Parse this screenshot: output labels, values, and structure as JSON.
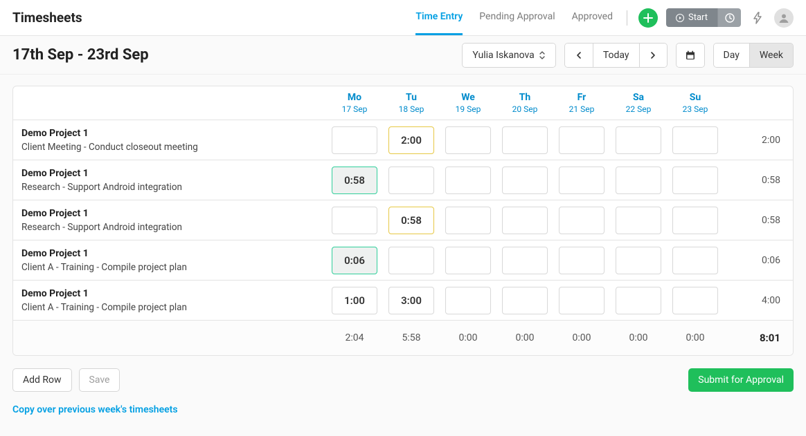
{
  "header": {
    "title": "Timesheets",
    "tabs": [
      "Time Entry",
      "Pending Approval",
      "Approved"
    ],
    "active_tab": 0,
    "start_label": "Start"
  },
  "subbar": {
    "date_range": "17th Sep - 23rd Sep",
    "user": "Yulia Iskanova",
    "today_label": "Today",
    "view": {
      "day": "Day",
      "week": "Week",
      "active": "week"
    }
  },
  "days": [
    {
      "short": "Mo",
      "date": "17 Sep"
    },
    {
      "short": "Tu",
      "date": "18 Sep"
    },
    {
      "short": "We",
      "date": "19 Sep"
    },
    {
      "short": "Th",
      "date": "20 Sep"
    },
    {
      "short": "Fr",
      "date": "21 Sep"
    },
    {
      "short": "Sa",
      "date": "22 Sep"
    },
    {
      "short": "Su",
      "date": "23 Sep"
    }
  ],
  "rows": [
    {
      "project": "Demo Project 1",
      "task": "Client Meeting - Conduct closeout meeting",
      "cells": [
        "",
        "2:00",
        "",
        "",
        "",
        "",
        ""
      ],
      "styles": [
        "",
        "yellow",
        "",
        "",
        "",
        "",
        ""
      ],
      "total": "2:00"
    },
    {
      "project": "Demo Project 1",
      "task": "Research - Support Android integration",
      "cells": [
        "0:58",
        "",
        "",
        "",
        "",
        "",
        ""
      ],
      "styles": [
        "green",
        "",
        "",
        "",
        "",
        "",
        ""
      ],
      "total": "0:58"
    },
    {
      "project": "Demo Project 1",
      "task": "Research - Support Android integration",
      "cells": [
        "",
        "0:58",
        "",
        "",
        "",
        "",
        ""
      ],
      "styles": [
        "",
        "yellow",
        "",
        "",
        "",
        "",
        ""
      ],
      "total": "0:58"
    },
    {
      "project": "Demo Project 1",
      "task": "Client A - Training - Compile project plan",
      "cells": [
        "0:06",
        "",
        "",
        "",
        "",
        "",
        ""
      ],
      "styles": [
        "green",
        "",
        "",
        "",
        "",
        "",
        ""
      ],
      "total": "0:06"
    },
    {
      "project": "Demo Project 1",
      "task": "Client A - Training - Compile project plan",
      "cells": [
        "1:00",
        "3:00",
        "",
        "",
        "",
        "",
        ""
      ],
      "styles": [
        "",
        "",
        "",
        "",
        "",
        "",
        ""
      ],
      "total": "4:00"
    }
  ],
  "day_totals": [
    "2:04",
    "5:58",
    "0:00",
    "0:00",
    "0:00",
    "0:00",
    "0:00"
  ],
  "grand_total": "8:01",
  "footer": {
    "add_row": "Add Row",
    "save": "Save",
    "submit": "Submit for Approval",
    "copy_link": "Copy over previous week's timesheets"
  }
}
